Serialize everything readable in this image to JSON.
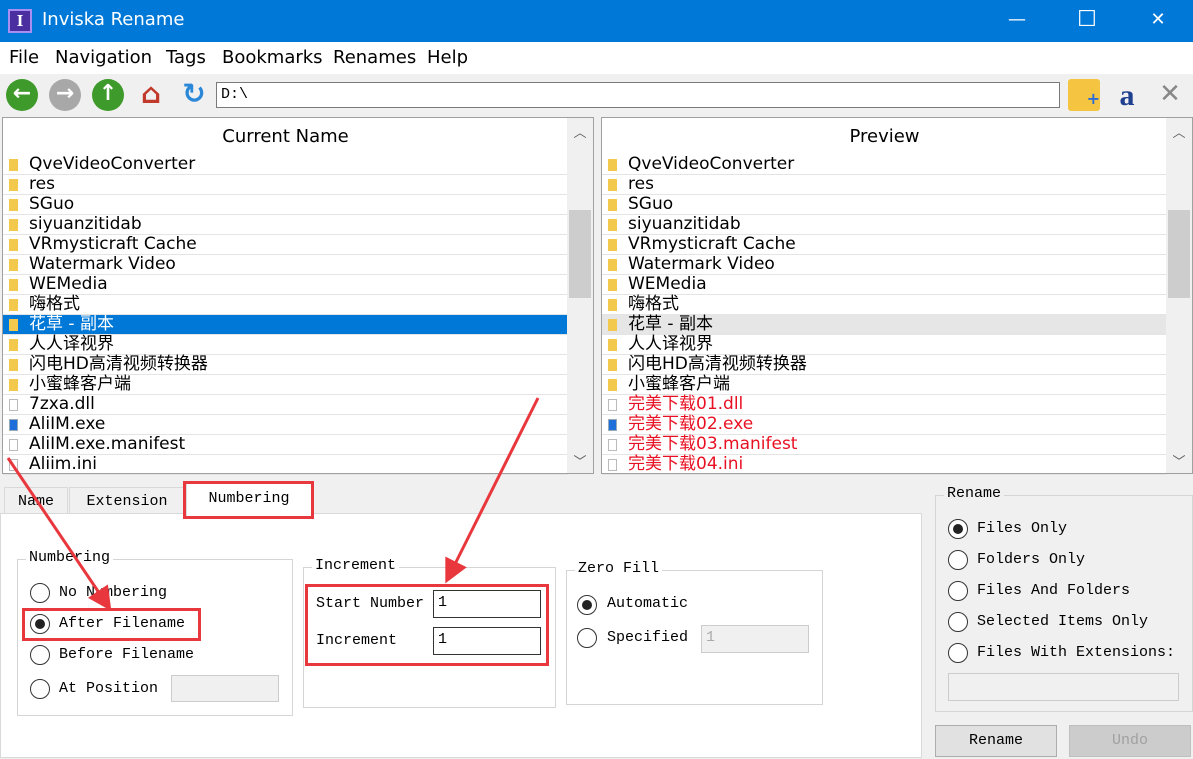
{
  "window": {
    "title": "Inviska Rename",
    "icon_letter": "I",
    "minimize": "—",
    "maximize": "☐",
    "close": "✕"
  },
  "menu": [
    "File",
    "Navigation",
    "Tags",
    "Bookmarks",
    "Renames",
    "Help"
  ],
  "toolbar": {
    "path": "D:\\"
  },
  "current": {
    "header": "Current Name",
    "items": [
      {
        "name": "QveVideoConverter",
        "type": "folder"
      },
      {
        "name": "res",
        "type": "folder"
      },
      {
        "name": "SGuo",
        "type": "folder"
      },
      {
        "name": "siyuanzitidab",
        "type": "folder"
      },
      {
        "name": "VRmysticraft Cache",
        "type": "folder"
      },
      {
        "name": "Watermark Video",
        "type": "folder"
      },
      {
        "name": "WEMedia",
        "type": "folder"
      },
      {
        "name": "嗨格式",
        "type": "folder"
      },
      {
        "name": "花草 - 副本",
        "type": "folder",
        "selected": true
      },
      {
        "name": "人人译视界",
        "type": "folder"
      },
      {
        "name": "闪电HD高清视频转换器",
        "type": "folder"
      },
      {
        "name": "小蜜蜂客户端",
        "type": "folder"
      },
      {
        "name": "7zxa.dll",
        "type": "file"
      },
      {
        "name": "AliIM.exe",
        "type": "exe"
      },
      {
        "name": "AliIM.exe.manifest",
        "type": "file"
      },
      {
        "name": "Aliim.ini",
        "type": "file"
      }
    ]
  },
  "preview": {
    "header": "Preview",
    "items": [
      {
        "name": "QveVideoConverter",
        "type": "folder"
      },
      {
        "name": "res",
        "type": "folder"
      },
      {
        "name": "SGuo",
        "type": "folder"
      },
      {
        "name": "siyuanzitidab",
        "type": "folder"
      },
      {
        "name": "VRmysticraft Cache",
        "type": "folder"
      },
      {
        "name": "Watermark Video",
        "type": "folder"
      },
      {
        "name": "WEMedia",
        "type": "folder"
      },
      {
        "name": "嗨格式",
        "type": "folder"
      },
      {
        "name": "花草 - 副本",
        "type": "folder",
        "selected": true
      },
      {
        "name": "人人译视界",
        "type": "folder"
      },
      {
        "name": "闪电HD高清视频转换器",
        "type": "folder"
      },
      {
        "name": "小蜜蜂客户端",
        "type": "folder"
      },
      {
        "name": "完美下载01.dll",
        "type": "file",
        "changed": true
      },
      {
        "name": "完美下载02.exe",
        "type": "exe",
        "changed": true
      },
      {
        "name": "完美下载03.manifest",
        "type": "file",
        "changed": true
      },
      {
        "name": "完美下载04.ini",
        "type": "file",
        "changed": true
      }
    ]
  },
  "tabs": {
    "name": "Name",
    "extension": "Extension",
    "numbering": "Numbering"
  },
  "numbering": {
    "title": "Numbering",
    "options": [
      "No Numbering",
      "After Filename",
      "Before Filename",
      "At Position"
    ],
    "selected": 1,
    "position_value": ""
  },
  "increment": {
    "title": "Increment",
    "start_label": "Start Number",
    "start_value": "1",
    "inc_label": "Increment",
    "inc_value": "1"
  },
  "zerofill": {
    "title": "Zero Fill",
    "automatic": "Automatic",
    "specified": "Specified",
    "specified_value": "1"
  },
  "rename_group": {
    "title": "Rename",
    "options": [
      "Files Only",
      "Folders Only",
      "Files And Folders",
      "Selected Items Only",
      "Files With Extensions:"
    ],
    "selected": 0,
    "extensions_value": ""
  },
  "buttons": {
    "rename": "Rename",
    "undo": "Undo"
  },
  "colors": {
    "titlebar": "#0078d7",
    "selection": "#0078d7",
    "changed": "#e81123",
    "annotation": "#e8383d"
  }
}
